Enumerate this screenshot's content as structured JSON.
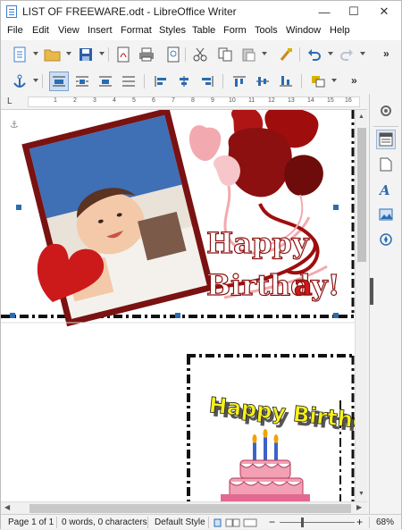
{
  "window": {
    "title": "LIST OF FREEWARE.odt - LibreOffice Writer",
    "min_glyph": "—",
    "max_glyph": "☐",
    "close_glyph": "✕"
  },
  "menu": [
    "File",
    "Edit",
    "View",
    "Insert",
    "Format",
    "Styles",
    "Table",
    "Form",
    "Tools",
    "Window",
    "Help"
  ],
  "ruler": {
    "numbers": [
      "1",
      "2",
      "3",
      "4",
      "5",
      "6",
      "7",
      "8",
      "9",
      "10",
      "11",
      "12",
      "13",
      "14",
      "15",
      "16"
    ]
  },
  "document": {
    "card1": {
      "line1": "Happy",
      "line2_a": "Birthd",
      "line2_b": "a",
      "line2_c": "y!"
    },
    "card2": {
      "wordart": "Happy Birthday"
    }
  },
  "status": {
    "page": "Page 1 of 1",
    "words": "0 words, 0 characters",
    "style": "Default Style",
    "zoom": "68%"
  },
  "colors": {
    "accent": "#2b6cb0",
    "heart_red": "#cc1a1a",
    "balloon_dark": "#8c1010",
    "balloon_pink": "#f2aab0"
  }
}
